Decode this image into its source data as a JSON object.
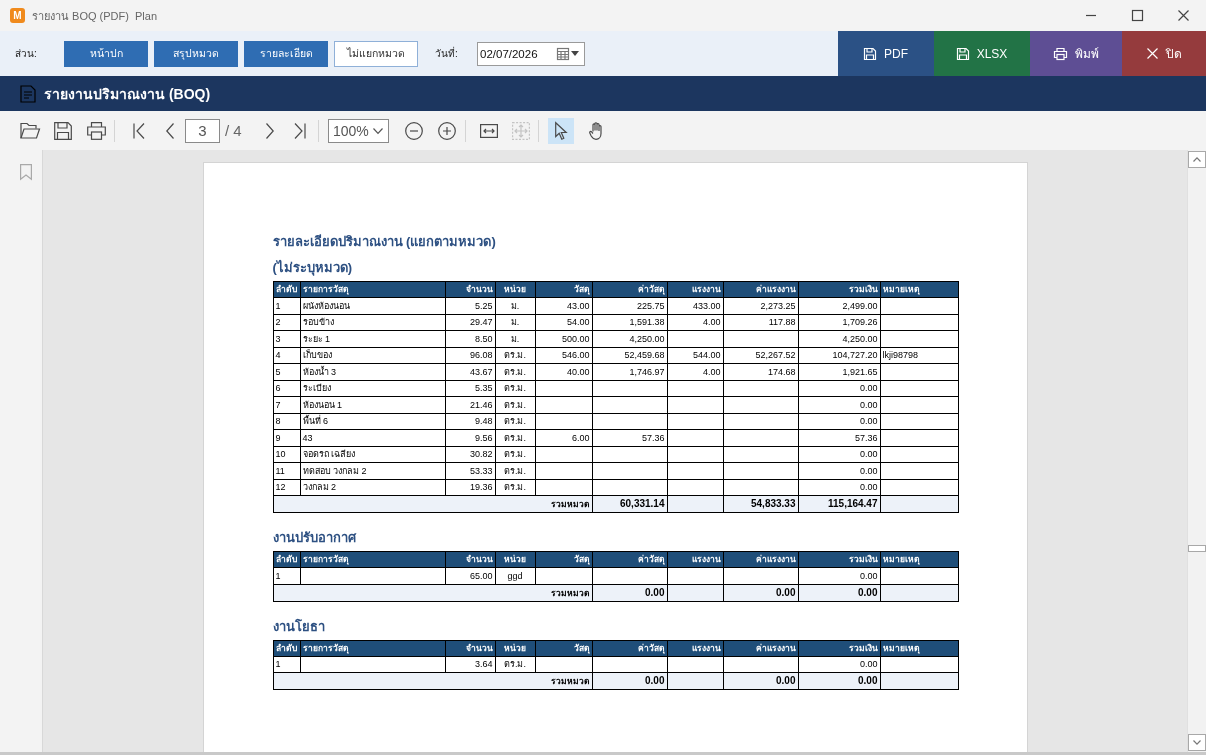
{
  "window": {
    "logo": "M",
    "title": "รายงาน BOQ (PDF)  Plan"
  },
  "ribbon": {
    "section_label": "ส่วน:",
    "sections": [
      {
        "label": "หน้าปก",
        "on": true
      },
      {
        "label": "สรุปหมวด",
        "on": true
      },
      {
        "label": "รายละเอียด",
        "on": true
      },
      {
        "label": "ไม่แยกหมวด",
        "on": false
      }
    ],
    "date_label": "วันที่:",
    "date": {
      "value": "02/07/2026"
    },
    "actions": [
      {
        "kind": "pdf",
        "label": "PDF"
      },
      {
        "kind": "xlsx",
        "label": "XLSX"
      },
      {
        "kind": "print",
        "label": "พิมพ์"
      },
      {
        "kind": "close",
        "label": "ปิด"
      }
    ]
  },
  "report_header": {
    "title": "รายงานปริมาณงาน (BOQ)"
  },
  "viewer_toolbar": {
    "page": {
      "value": "3"
    },
    "page_total": "/ 4",
    "zoom": "100%",
    "view_buttons": [
      {
        "kind": "fit-width",
        "disabled": false
      },
      {
        "kind": "fit-page",
        "disabled": true
      }
    ],
    "tools": [
      {
        "kind": "select",
        "selected": true
      },
      {
        "kind": "hand",
        "selected": false
      }
    ]
  },
  "document": {
    "title": "รายละเอียดปริมาณงาน (แยกตามหมวด)",
    "groups": [
      {
        "title": "(ไม่ระบุหมวด)",
        "columns": [
          "ลำดับ",
          "รายการวัสดุ",
          "จำนวน",
          "หน่วย",
          "วัสดุ",
          "ค่าวัสดุ",
          "แรงงาน",
          "ค่าแรงงาน",
          "รวมเงิน",
          "หมายเหตุ"
        ],
        "rows": [
          {
            "no": "1",
            "item": "ผนังห้องนอน",
            "qty": "5.25",
            "unit": "ม.",
            "material": "43.00",
            "material_cost": "225.75",
            "labor": "433.00",
            "labor_cost": "2,273.25",
            "amount": "2,499.00"
          },
          {
            "no": "2",
            "item": "รอบข้าง",
            "qty": "29.47",
            "unit": "ม.",
            "material": "54.00",
            "material_cost": "1,591.38",
            "labor": "4.00",
            "labor_cost": "117.88",
            "amount": "1,709.26"
          },
          {
            "no": "3",
            "item": "ระยะ 1",
            "qty": "8.50",
            "unit": "ม.",
            "material": "500.00",
            "material_cost": "4,250.00",
            "amount": "4,250.00"
          },
          {
            "no": "4",
            "item": "เก็บของ",
            "qty": "96.08",
            "unit": "ตร.ม.",
            "material": "546.00",
            "material_cost": "52,459.68",
            "labor": "544.00",
            "labor_cost": "52,267.52",
            "amount": "104,727.20",
            "note": "lkji98798"
          },
          {
            "no": "5",
            "item": "ห้องน้ำ 3",
            "qty": "43.67",
            "unit": "ตร.ม.",
            "material": "40.00",
            "material_cost": "1,746.97",
            "labor": "4.00",
            "labor_cost": "174.68",
            "amount": "1,921.65"
          },
          {
            "no": "6",
            "item": "ระเบียง",
            "qty": "5.35",
            "unit": "ตร.ม.",
            "amount": "0.00"
          },
          {
            "no": "7",
            "item": "ห้องนอน 1",
            "qty": "21.46",
            "unit": "ตร.ม.",
            "amount": "0.00"
          },
          {
            "no": "8",
            "item": "พื้นที่ 6",
            "qty": "9.48",
            "unit": "ตร.ม.",
            "amount": "0.00"
          },
          {
            "no": "9",
            "item": "43",
            "qty": "9.56",
            "unit": "ตร.ม.",
            "material": "6.00",
            "material_cost": "57.36",
            "amount": "57.36"
          },
          {
            "no": "10",
            "item": "จอดรถ เฉลียง",
            "qty": "30.82",
            "unit": "ตร.ม.",
            "amount": "0.00"
          },
          {
            "no": "11",
            "item": "ทดสอบ วงกลม 2",
            "qty": "53.33",
            "unit": "ตร.ม.",
            "amount": "0.00"
          },
          {
            "no": "12",
            "item": "วงกลม 2",
            "qty": "19.36",
            "unit": "ตร.ม.",
            "amount": "0.00"
          }
        ],
        "total": {
          "label": "รวมหมวด",
          "material_cost": "60,331.14",
          "labor_cost": "54,833.33",
          "amount": "115,164.47"
        }
      },
      {
        "title": "งานปรับอากาศ",
        "columns": [
          "ลำดับ",
          "รายการวัสดุ",
          "จำนวน",
          "หน่วย",
          "วัสดุ",
          "ค่าวัสดุ",
          "แรงงาน",
          "ค่าแรงงาน",
          "รวมเงิน",
          "หมายเหตุ"
        ],
        "rows": [
          {
            "no": "1",
            "qty": "65.00",
            "unit": "ggd",
            "amount": "0.00"
          }
        ],
        "total": {
          "label": "รวมหมวด",
          "material_cost": "0.00",
          "labor_cost": "0.00",
          "amount": "0.00"
        }
      },
      {
        "title": "งานโยธา",
        "columns": [
          "ลำดับ",
          "รายการวัสดุ",
          "จำนวน",
          "หน่วย",
          "วัสดุ",
          "ค่าวัสดุ",
          "แรงงาน",
          "ค่าแรงงาน",
          "รวมเงิน",
          "หมายเหตุ"
        ],
        "rows": [
          {
            "no": "1",
            "qty": "3.64",
            "unit": "ตร.ม.",
            "amount": "0.00"
          }
        ],
        "total": {
          "label": "รวมหมวด",
          "material_cost": "0.00",
          "labor_cost": "0.00",
          "amount": "0.00"
        }
      }
    ]
  }
}
